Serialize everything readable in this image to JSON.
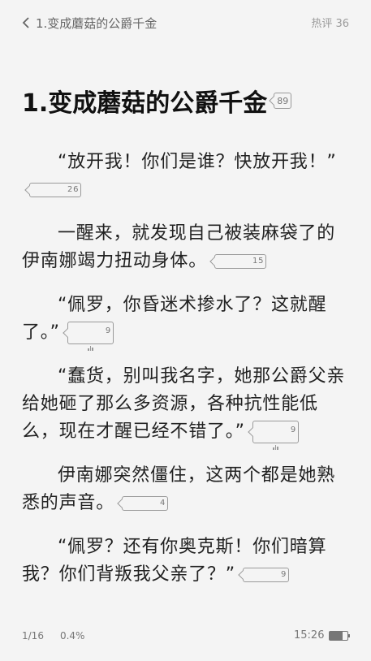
{
  "topbar": {
    "back_title": "1.变成蘑菇的公爵千金",
    "hot_comments": "热评 36"
  },
  "chapter": {
    "title": "1.变成蘑菇的公爵千金",
    "title_comment_count": "89"
  },
  "paragraphs": [
    {
      "text": "“放开我！你们是谁？快放开我！”",
      "comment_count": "26"
    },
    {
      "text": "一醒来，就发现自己被装麻袋了的伊南娜竭力扭动身体。",
      "comment_count": "15"
    },
    {
      "text": "“佩罗，你昏迷术掺水了？这就醒了。”",
      "comment_count": "9"
    },
    {
      "text": "“蠢货，别叫我名字，她那公爵父亲给她砸了那么多资源，各种抗性能低么，现在才醒已经不错了。”",
      "comment_count": "9"
    },
    {
      "text": "伊南娜突然僵住，这两个都是她熟悉的声音。",
      "comment_count": "4"
    },
    {
      "text": "“佩罗？还有你奥克斯！你们暗算我？你们背叛我父亲了？”",
      "comment_count": "9"
    }
  ],
  "footer": {
    "page": "1/16",
    "progress": "0.4%",
    "time": "15:26",
    "battery_level": 0.7
  },
  "icons": {
    "back": "chevron-left-icon",
    "comment": "comment-bubble-icon",
    "battery": "battery-icon"
  },
  "colors": {
    "background": "#f4f4f4",
    "text": "#222222",
    "muted": "#9a9a9a"
  }
}
